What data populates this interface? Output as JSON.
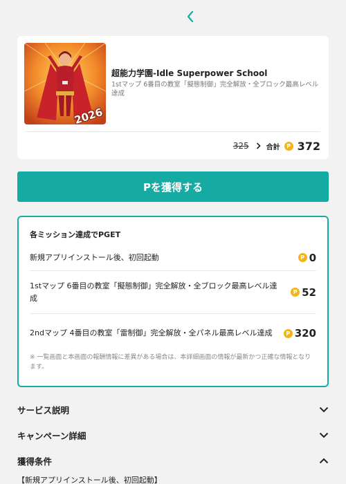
{
  "nav": {
    "back_icon": "chevron-left-icon"
  },
  "offer": {
    "title": "超能力学園-Idle Superpower School",
    "description": "1stマップ 6番目の教室「擬態制御」完全解放・全ブロック最高レベル達成",
    "thumbnail_badge": "2026",
    "old_points": "325",
    "total_label": "合計",
    "coin_symbol": "P",
    "total_points": "372"
  },
  "cta": {
    "label": "Pを獲得する"
  },
  "missions": {
    "heading": "各ミッション達成でPGET",
    "items": [
      {
        "text": "新規アプリインストール後、初回起動",
        "points": "0"
      },
      {
        "text": "1stマップ 6番目の教室「擬態制御」完全解放・全ブロック最高レベル達成",
        "points": "52"
      },
      {
        "text": "2ndマップ 4番目の教室「雷制御」完全解放・全パネル最高レベル達成",
        "points": "320"
      }
    ],
    "note": "※ 一覧画面と本画面の報酬情報に差異がある場合は、本詳細画面の情報が最新かつ正確な情報となります。"
  },
  "sections": [
    {
      "title": "サービス説明",
      "state": "collapsed"
    },
    {
      "title": "キャンペーン詳細",
      "state": "collapsed"
    },
    {
      "title": "獲得条件",
      "state": "expanded"
    }
  ],
  "conditions": {
    "first_line": "【新規アプリインストール後、初回起動】"
  },
  "colors": {
    "accent": "#15aba2",
    "coin": "#f1b419",
    "background": "#f2f2f2"
  }
}
